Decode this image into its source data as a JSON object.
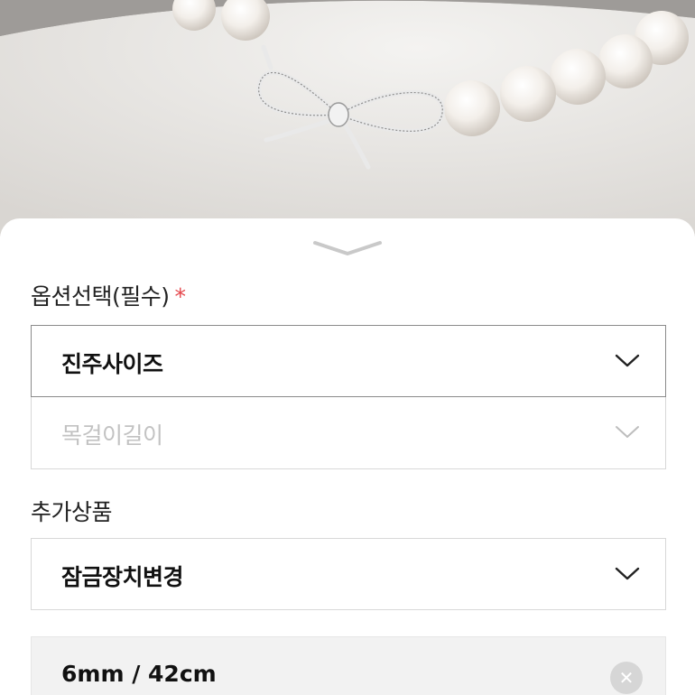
{
  "hero": {
    "image_icon": "pearl-necklace-bow-photo"
  },
  "sheet": {
    "collapse_icon": "chevron-down-icon"
  },
  "options": {
    "title": "옵션선택(필수)",
    "required_mark": "*",
    "selects": [
      {
        "label": "진주사이즈",
        "state": "enabled"
      },
      {
        "label": "목걸이길이",
        "state": "disabled"
      }
    ]
  },
  "extras": {
    "title": "추가상품",
    "select_label": "잠금장치변경"
  },
  "selected_item": {
    "label": "6mm / 42cm",
    "remove_icon": "close-icon",
    "remove_glyph": "✕"
  },
  "colors": {
    "required": "#e5484d",
    "disabled_text": "#c2c2c2",
    "selected_bg": "#f2f2f2"
  }
}
